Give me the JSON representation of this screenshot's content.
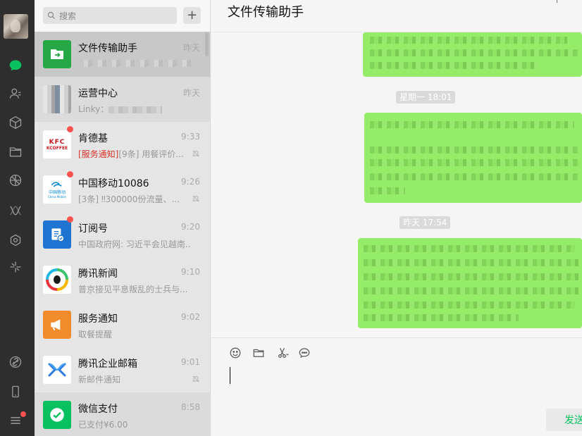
{
  "sidebar": {
    "icons": [
      "chat-icon",
      "contacts-icon",
      "favorites-icon",
      "files-icon",
      "moments-icon",
      "channels-icon",
      "miniprogram-icon",
      "search-discover-icon",
      "link-icon",
      "phone-icon",
      "menu-icon"
    ],
    "active_color": "#07c160",
    "badge_color": "#fa5151"
  },
  "search": {
    "placeholder": "搜索",
    "add_label": "+"
  },
  "conversations": [
    {
      "name": "文件传输助手",
      "time": "昨天",
      "preview": "",
      "unread": false,
      "muted": false
    },
    {
      "name": "运营中心",
      "time": "昨天",
      "preview": "Linky：",
      "unread": false,
      "muted": false
    },
    {
      "name": "肯德基",
      "time": "9:33",
      "preview_tag": "[服务通知]",
      "preview": "[9条] 用餐评价...",
      "unread": true,
      "muted": true
    },
    {
      "name": "中国移动10086",
      "time": "9:26",
      "preview": "[3条] ‼300000份流量、...",
      "unread": true,
      "muted": true
    },
    {
      "name": "订阅号",
      "time": "9:20",
      "preview": "中国政府网: 习近平会见越南...",
      "unread": true,
      "muted": false
    },
    {
      "name": "腾讯新闻",
      "time": "9:10",
      "preview": "普京接见平息叛乱的士兵与...",
      "unread": false,
      "muted": false
    },
    {
      "name": "服务通知",
      "time": "9:02",
      "preview": "取餐提醒",
      "unread": false,
      "muted": false
    },
    {
      "name": "腾讯企业邮箱",
      "time": "9:01",
      "preview": "新邮件通知",
      "unread": false,
      "muted": true
    },
    {
      "name": "微信支付",
      "time": "8:58",
      "preview": "已支付¥6.00",
      "unread": false,
      "muted": false
    }
  ],
  "logo_text": {
    "kfc": "KFC",
    "kcoffee": "KCOFFEE",
    "cmcc": "中国移动",
    "cmcc_en": "China Mobile"
  },
  "chat": {
    "title": "文件传输助手",
    "timestamps": [
      "星期一 18:01",
      "昨天 17:54"
    ],
    "bubble_color": "#95ec69",
    "send_label": "发送"
  },
  "toolbar": {
    "icons": [
      "emoji-icon",
      "folder-icon",
      "scissors-icon",
      "chat-history-icon"
    ]
  }
}
